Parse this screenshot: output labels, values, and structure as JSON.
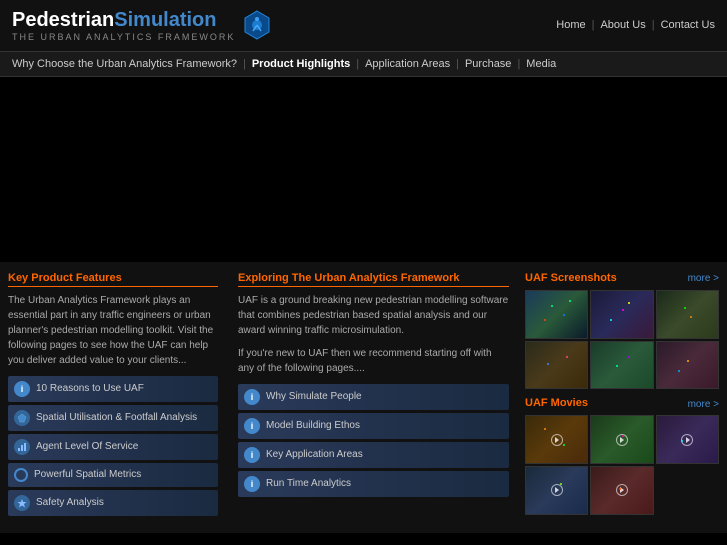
{
  "header": {
    "logo_ped": "Pedestrian",
    "logo_sim": "Simulation",
    "logo_subtitle": "The Urban Analytics Framework",
    "nav_home": "Home",
    "nav_about": "About Us",
    "nav_contact": "Contact Us"
  },
  "subnav": {
    "items": [
      "Why Choose the Urban Analytics Framework?",
      "Product Highlights",
      "Application Areas",
      "Purchase",
      "Media"
    ]
  },
  "left": {
    "title": "Key Product Features",
    "description": "The Urban Analytics Framework plays an essential part in any traffic engineers or urban planner's pedestrian modelling toolkit. Visit the following pages to see how the UAF can help you deliver added value to your clients...",
    "features": [
      {
        "label": "10 Reasons to Use UAF",
        "icon": "i"
      },
      {
        "label": "Spatial Utilisation & Footfall Analysis",
        "icon": "map"
      },
      {
        "label": "Agent Level Of Service",
        "icon": "bar"
      },
      {
        "label": "Powerful Spatial Metrics",
        "icon": "ring"
      },
      {
        "label": "Safety Analysis",
        "icon": "star"
      }
    ]
  },
  "mid": {
    "title": "Exploring The Urban Analytics Framework",
    "description1": "UAF is a ground breaking new pedestrian modelling software that combines pedestrian based spatial analysis and our award winning traffic microsimulation.",
    "description2": "If you're new to UAF then we recommend starting off with any of the following pages....",
    "items": [
      {
        "label": "Why Simulate People",
        "icon": "i"
      },
      {
        "label": "Model Building Ethos",
        "icon": "i"
      },
      {
        "label": "Key Application Areas",
        "icon": "i"
      },
      {
        "label": "Run Time Analytics",
        "icon": "i"
      }
    ]
  },
  "right": {
    "screenshots_title": "UAF Screenshots",
    "screenshots_more": "more >",
    "movies_title": "UAF Movies",
    "movies_more": "more >"
  }
}
